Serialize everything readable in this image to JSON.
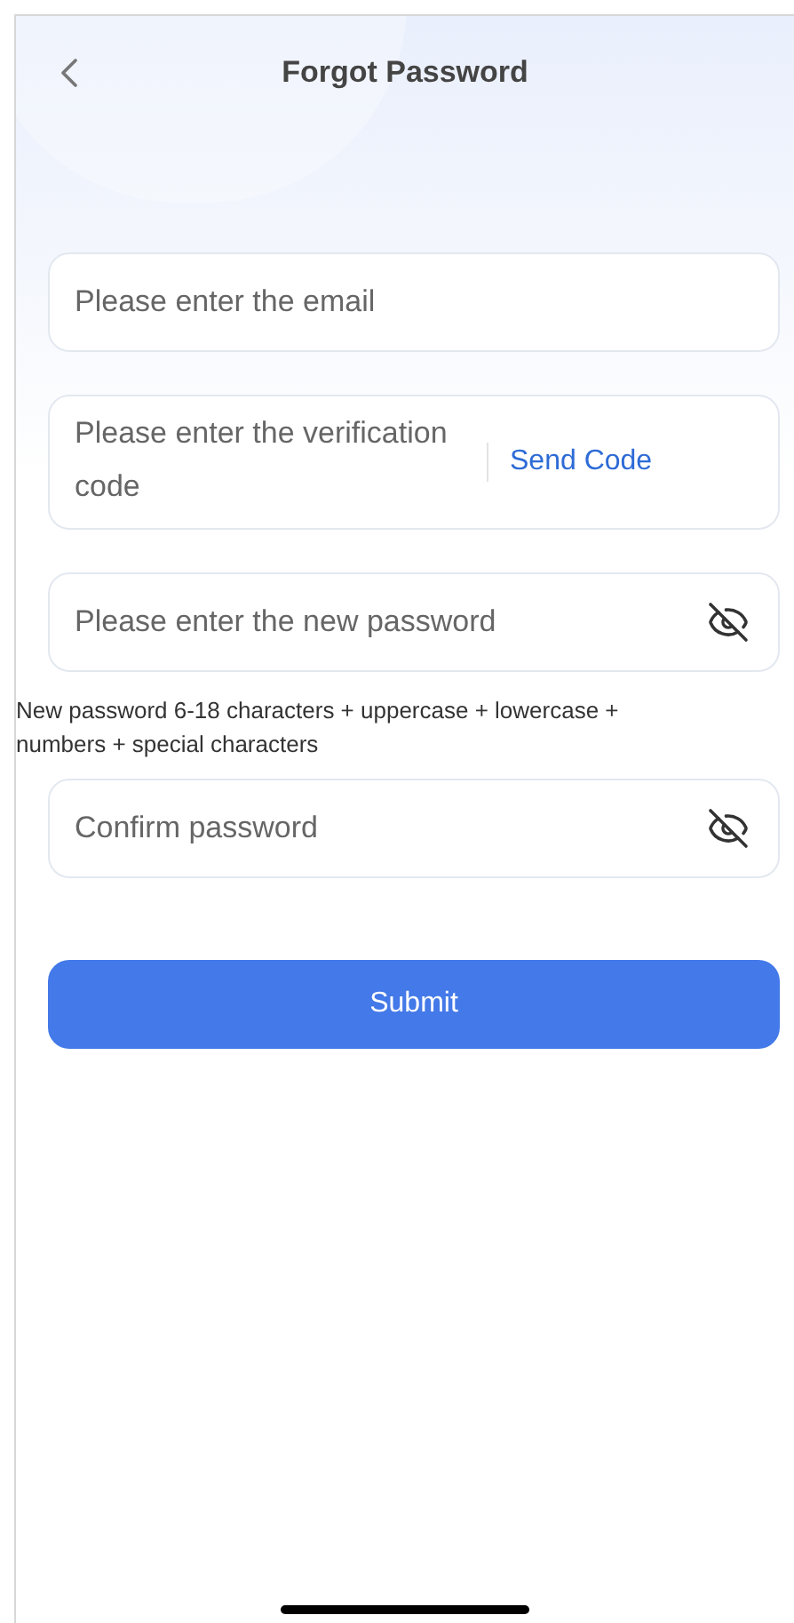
{
  "header": {
    "title": "Forgot Password"
  },
  "fields": [
    {
      "kind": "text",
      "placeholder": "Please enter the email"
    },
    {
      "kind": "code",
      "placeholder": "Please enter the verification code",
      "action": "Send Code"
    },
    {
      "kind": "password",
      "placeholder": "Please enter the new password",
      "visible": false,
      "hint": "New password 6-18 characters + uppercase + lowercase + numbers + special characters"
    },
    {
      "kind": "password",
      "placeholder": "Confirm password",
      "visible": false
    }
  ],
  "submit": "Submit"
}
